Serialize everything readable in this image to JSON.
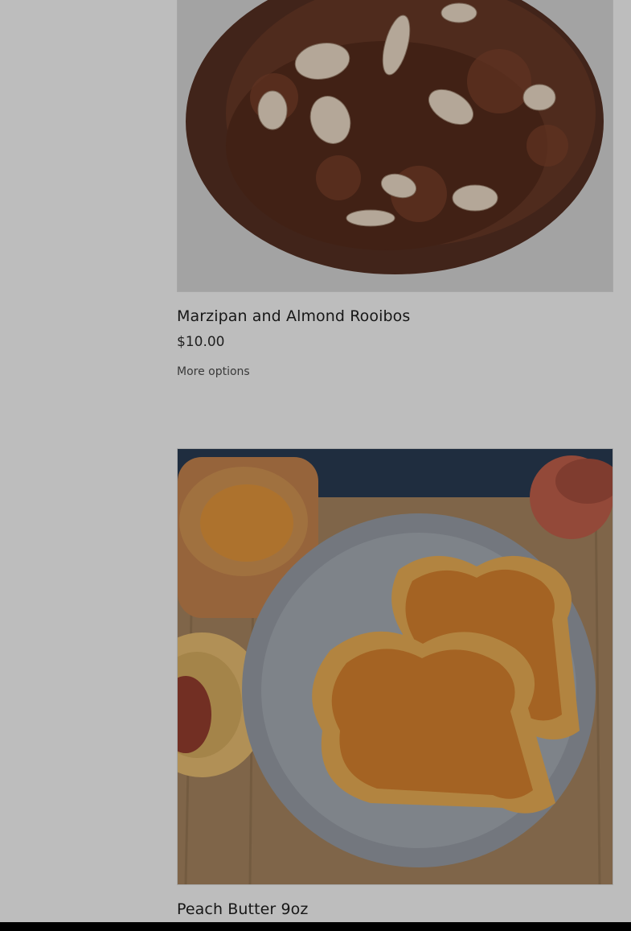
{
  "products": [
    {
      "title": "Marzipan and Almond Rooibos",
      "price": "$10.00",
      "options_label": "More options",
      "image_icon": "rooibos-tea-leaves-photo"
    },
    {
      "title": "Peach Butter 9oz",
      "image_icon": "peach-butter-toast-photo"
    }
  ],
  "colors": {
    "overlay": "#bdbdbd",
    "bottom_bar": "#000000"
  }
}
